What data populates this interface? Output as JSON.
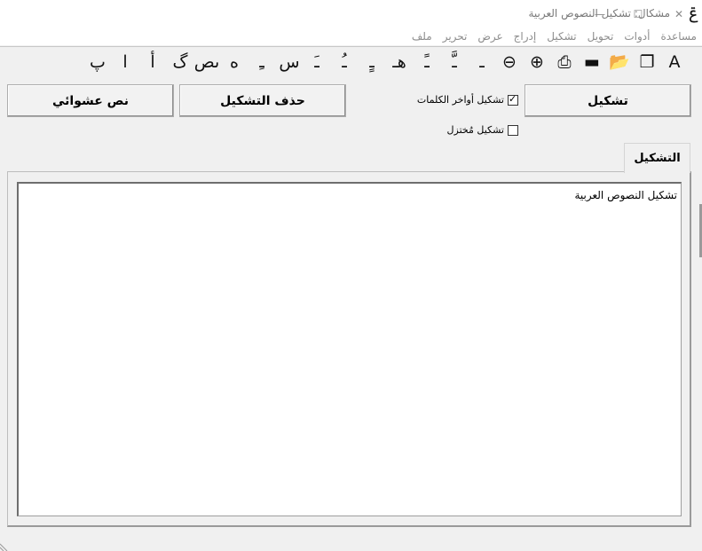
{
  "window": {
    "title": "مشكال: تشكيل النصوص العربية",
    "app_icon_glyph": "ݝ",
    "controls": {
      "minimize": "—",
      "maximize": "☐",
      "close": "✕"
    }
  },
  "menu": {
    "items": [
      "ملف",
      "تحرير",
      "عرض",
      "إدراج",
      "تشكيل",
      "تحويل",
      "أدوات",
      "مساعدة"
    ]
  },
  "toolbar": {
    "buttons": [
      {
        "name": "font-icon",
        "glyph": "A"
      },
      {
        "name": "copy-icon",
        "glyph": "❐"
      },
      {
        "name": "open-folder-icon",
        "glyph": "📂"
      },
      {
        "name": "save-icon",
        "glyph": "▬"
      },
      {
        "name": "print-icon",
        "glyph": "⎙"
      },
      {
        "name": "zoom-in-icon",
        "glyph": "⊕"
      },
      {
        "name": "zoom-out-icon",
        "glyph": "⊖"
      },
      {
        "name": "tatweel-icon",
        "glyph": "ـ"
      },
      {
        "name": "shadda-fatha-icon",
        "glyph": "ـَّ"
      },
      {
        "name": "shadda-kasra-icon",
        "glyph": "ـً"
      },
      {
        "name": "ha-icon",
        "glyph": "هـ"
      },
      {
        "name": "kasratan-icon",
        "glyph": "ـٍ"
      },
      {
        "name": "damma-icon",
        "glyph": "ـُ"
      },
      {
        "name": "fatha-icon",
        "glyph": "ـَ"
      },
      {
        "name": "seen-icon",
        "glyph": "س"
      },
      {
        "name": "kasra-icon",
        "glyph": "ـِ"
      },
      {
        "name": "ha-dotted-icon",
        "glyph": "ه"
      },
      {
        "name": "nun-sad-icon",
        "glyph": "ںص"
      },
      {
        "name": "gaf-icon",
        "glyph": "گ"
      },
      {
        "name": "alif-hamza-icon",
        "glyph": "أ"
      },
      {
        "name": "alif-dotted-icon",
        "glyph": "ا"
      },
      {
        "name": "peh-icon",
        "glyph": "پ"
      }
    ]
  },
  "actions": {
    "tashkeel_button": "تشكيل",
    "remove_tashkeel_button": "حذف التشكيل",
    "random_text_button": "نص عشوائي"
  },
  "options": {
    "word_endings": {
      "label": "تشكيل أواخر الكلمات",
      "checked": true
    },
    "abbreviated": {
      "label": "تشكيل مُختزل",
      "checked": false
    }
  },
  "tabs": {
    "active": "التشكيل"
  },
  "editor": {
    "text": "تشكيل النصوص العربية"
  }
}
